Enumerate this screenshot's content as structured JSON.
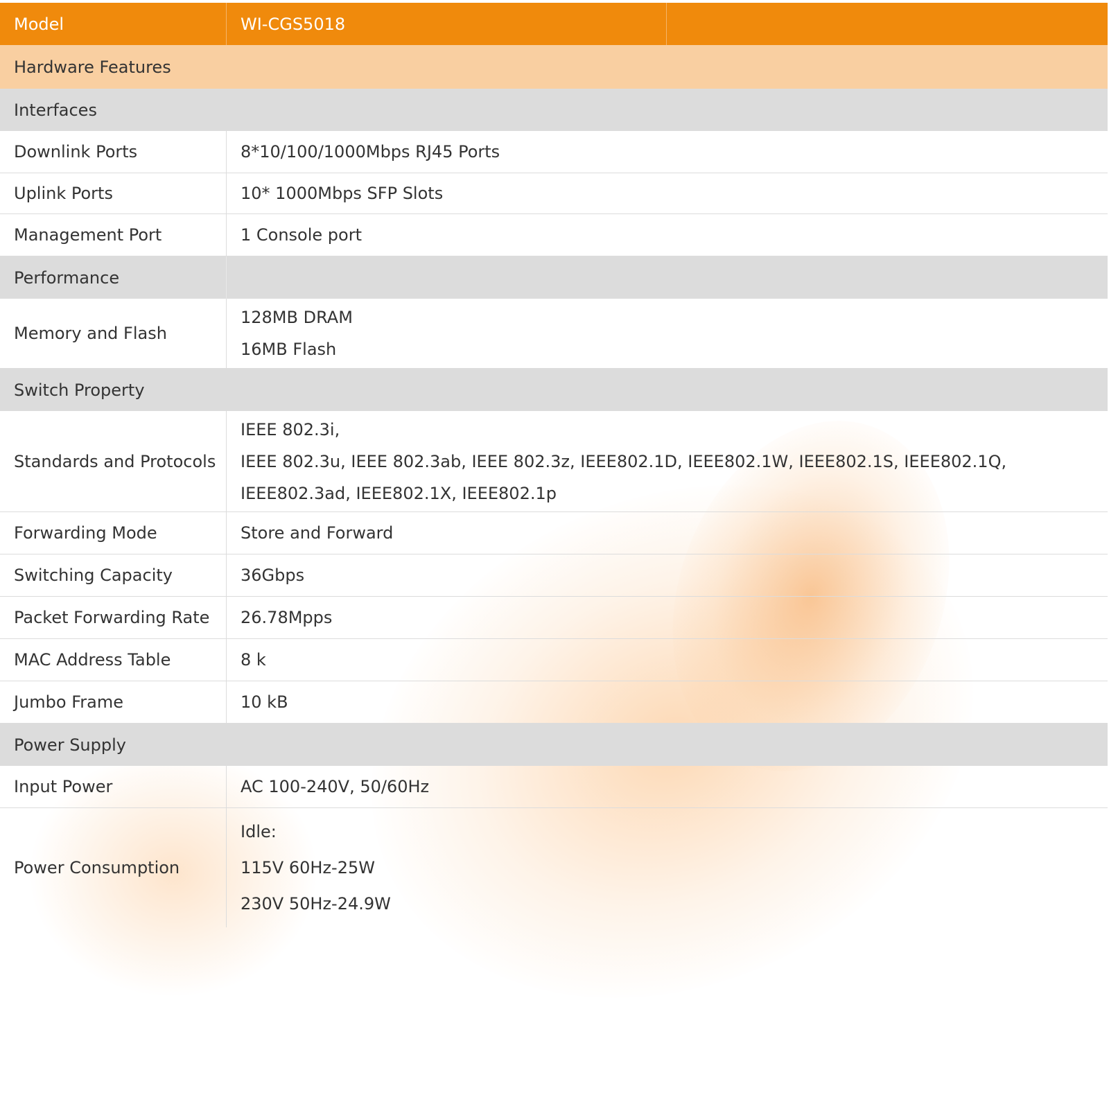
{
  "header": {
    "model_label": "Model",
    "model_value": "WI-CGS5018"
  },
  "hardware_features": "Hardware Features",
  "sections": {
    "interfaces": "Interfaces",
    "performance": "Performance",
    "switch_property": "Switch Property",
    "power_supply": "Power Supply"
  },
  "rows": {
    "downlink_ports": {
      "label": "Downlink Ports",
      "value": "8*10/100/1000Mbps RJ45 Ports"
    },
    "uplink_ports": {
      "label": "Uplink Ports",
      "value": "10* 1000Mbps SFP Slots"
    },
    "management_port": {
      "label": "Management Port",
      "value": "1 Console port"
    },
    "memory_flash": {
      "label": "Memory and Flash",
      "values": [
        "128MB DRAM",
        "16MB Flash"
      ]
    },
    "standards": {
      "label": "Standards and Protocols",
      "values": [
        "IEEE 802.3i,",
        "IEEE 802.3u, IEEE 802.3ab, IEEE 802.3z, IEEE802.1D, IEEE802.1W, IEEE802.1S, IEEE802.1Q,",
        "IEEE802.3ad, IEEE802.1X, IEEE802.1p"
      ]
    },
    "forwarding_mode": {
      "label": "Forwarding Mode",
      "value": "Store and Forward"
    },
    "switching_capacity": {
      "label": "Switching Capacity",
      "value": "36Gbps"
    },
    "packet_forwarding": {
      "label": "Packet Forwarding Rate",
      "value": "26.78Mpps"
    },
    "mac_table": {
      "label": "MAC Address Table",
      "value": "8 k"
    },
    "jumbo_frame": {
      "label": "Jumbo Frame",
      "value": "10 kB"
    },
    "input_power": {
      "label": "Input Power",
      "value": "AC 100-240V, 50/60Hz"
    },
    "power_consumption": {
      "label": "Power Consumption",
      "values": [
        "Idle:",
        "115V 60Hz-25W",
        "230V 50Hz-24.9W"
      ]
    }
  },
  "colors": {
    "header_orange": "#f08a0c",
    "hardware_peach": "#f9cfa1",
    "section_gray": "#dcdcdc"
  }
}
